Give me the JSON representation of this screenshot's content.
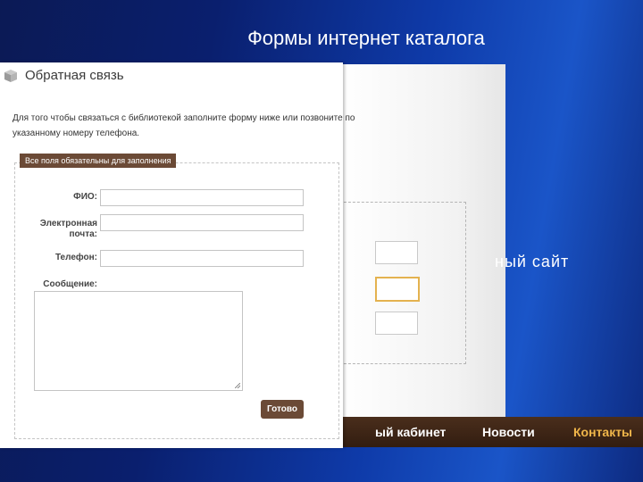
{
  "slide": {
    "title": "Формы интернет каталога",
    "partial_text": "ный сайт"
  },
  "background_site": {
    "nav": [
      {
        "label": "ый кабинет",
        "active": false
      },
      {
        "label": "Новости",
        "active": false
      },
      {
        "label": "Контакты",
        "active": true
      }
    ]
  },
  "feedback": {
    "icon": "cube-icon",
    "heading": "Обратная связь",
    "intro_line1": "Для того чтобы связаться с библиотекой заполните форму ниже или позвоните по",
    "intro_line2": "указанному номеру телефона.",
    "required_note": "Все поля обязательны для заполнения",
    "fields": {
      "name_label": "ФИО:",
      "email_label_1": "Электронная",
      "email_label_2": "почта:",
      "phone_label": "Телефон:",
      "message_label": "Сообщение:"
    },
    "submit_label": "Готово"
  },
  "colors": {
    "button_brown": "#6b4a36",
    "nav_active": "#f0b64a",
    "slide_blue": "#0e3aa8"
  }
}
